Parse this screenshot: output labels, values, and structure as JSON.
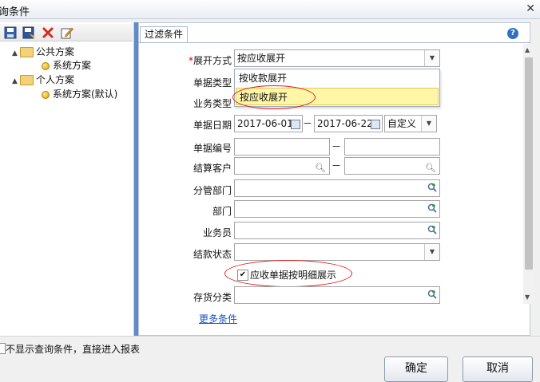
{
  "window": {
    "title": "询条件",
    "close": "✕"
  },
  "left": {
    "toolbar": [
      "save-icon",
      "save-as-icon",
      "delete-icon",
      "edit-icon"
    ],
    "tree": [
      {
        "label": "公共方案",
        "type": "folder",
        "expanded": true
      },
      {
        "label": "系统方案",
        "type": "item"
      },
      {
        "label": "个人方案",
        "type": "folder",
        "expanded": true
      },
      {
        "label": "系统方案(默认)",
        "type": "item"
      }
    ]
  },
  "tab": {
    "label": "过滤条件"
  },
  "form": {
    "expand_mode": {
      "label": "展开方式",
      "value": "按应收展开"
    },
    "dropdown_options": [
      "按收款展开",
      "按应收展开"
    ],
    "doc_type": {
      "label": "单据类型"
    },
    "biz_type": {
      "label": "业务类型"
    },
    "doc_date": {
      "label": "单据日期",
      "from": "2017-06-01",
      "to": "2017-06-22",
      "range": "自定义"
    },
    "doc_no": {
      "label": "单据编号"
    },
    "customer": {
      "label": "结算客户"
    },
    "dept_mgr": {
      "label": "分管部门"
    },
    "dept": {
      "label": "部门"
    },
    "salesman": {
      "label": "业务员"
    },
    "settle_status": {
      "label": "结款状态"
    },
    "detail_checkbox": {
      "label": "应收单据按明细展示",
      "checked": true
    },
    "inventory": {
      "label": "存货分类"
    },
    "more_link": "更多条件",
    "dash": "－"
  },
  "bottom": {
    "skip_checkbox": "不显示查询条件，直接进入报表",
    "ok": "确定",
    "cancel": "取消"
  },
  "colors": {
    "divider": "#5f8bc9",
    "highlight": "#fff6a8",
    "annotation": "#e02020"
  }
}
